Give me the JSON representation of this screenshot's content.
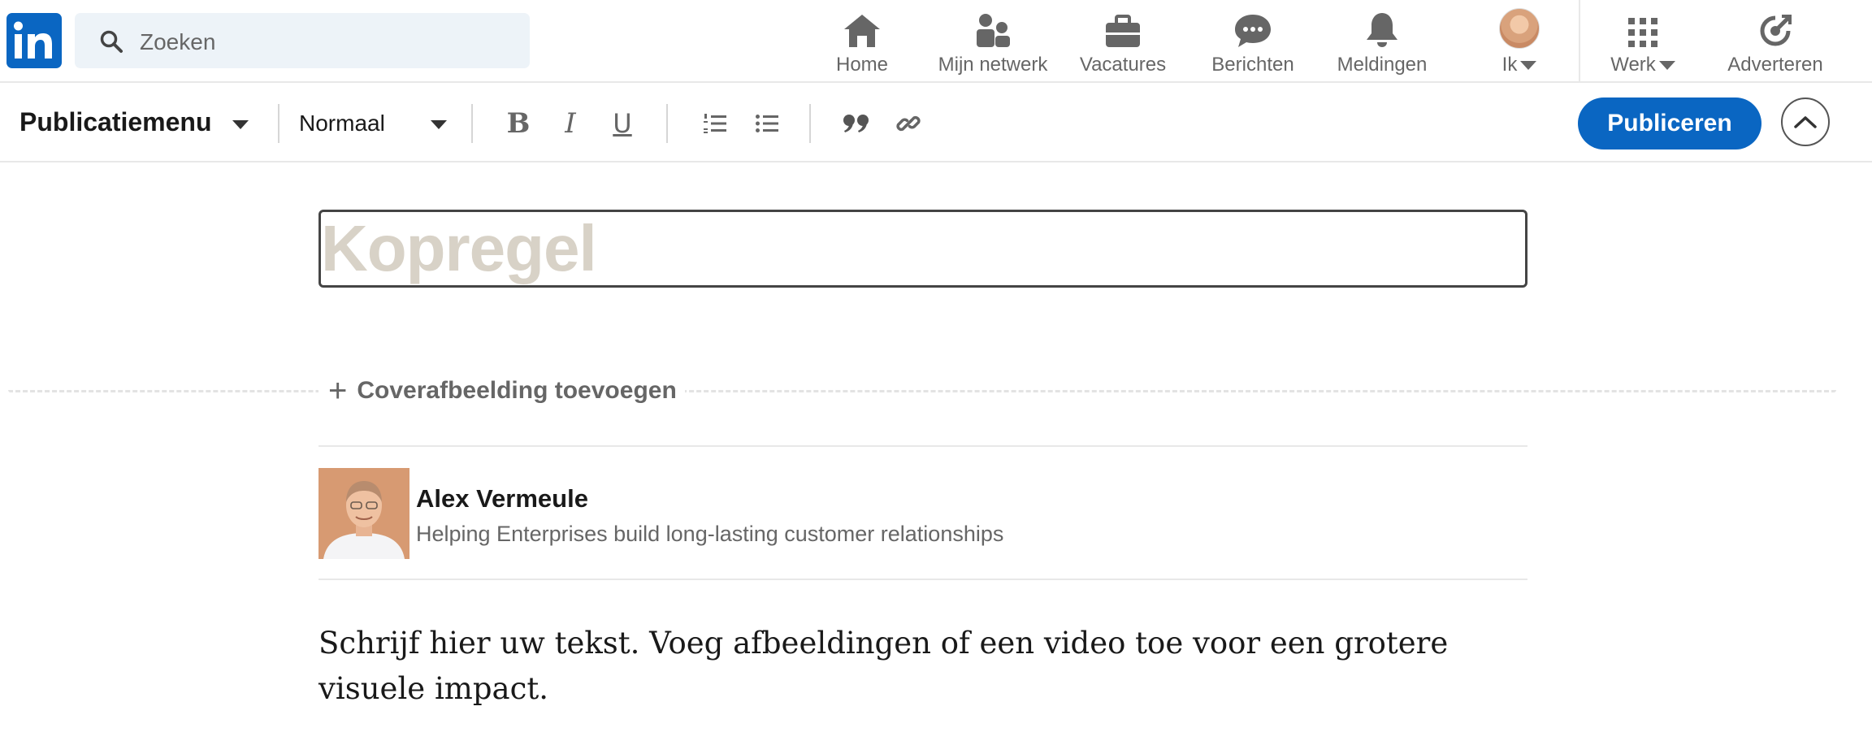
{
  "nav": {
    "search_placeholder": "Zoeken",
    "items": [
      {
        "label": "Home",
        "icon": "home-icon"
      },
      {
        "label": "Mijn netwerk",
        "icon": "network-icon"
      },
      {
        "label": "Vacatures",
        "icon": "briefcase-icon"
      },
      {
        "label": "Berichten",
        "icon": "messaging-icon"
      },
      {
        "label": "Meldingen",
        "icon": "bell-icon"
      },
      {
        "label": "Ik",
        "icon": "avatar"
      },
      {
        "label": "Werk",
        "icon": "grid-icon"
      },
      {
        "label": "Adverteren",
        "icon": "advertise-icon"
      }
    ]
  },
  "toolbar": {
    "publication_menu": "Publicatiemenu",
    "text_style": "Normaal",
    "bold_label": "B",
    "italic_label": "I",
    "underline_label": "U",
    "publish_label": "Publiceren"
  },
  "editor": {
    "headline_placeholder": "Kopregel",
    "add_cover_label": "Coverafbeelding toevoegen",
    "author_name": "Alex Vermeule",
    "author_headline": "Helping Enterprises build long-lasting customer relationships",
    "body_placeholder": "Schrijf hier uw tekst. Voeg afbeeldingen of een video toe voor een grotere visuele impact."
  },
  "colors": {
    "brand": "#0a66c2",
    "icon_gray": "#666666",
    "placeholder": "#d8d2c7"
  }
}
